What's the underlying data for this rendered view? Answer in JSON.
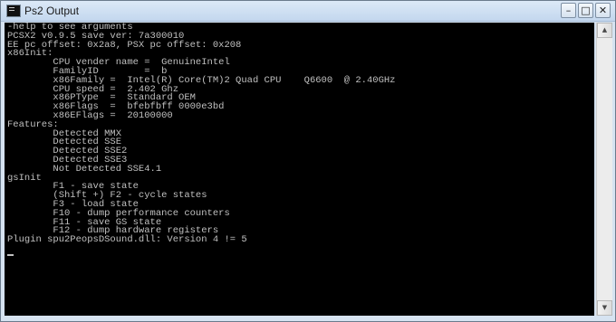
{
  "window": {
    "title": "Ps2 Output",
    "controls": {
      "minimize_glyph": "–",
      "maximize_glyph": "□",
      "close_glyph": "✕"
    },
    "icon": "console-app-icon"
  },
  "console": {
    "background": "#000000",
    "text_color": "#c0c0c0",
    "lines": [
      "-help to see arguments",
      "PCSX2 v0.9.5 save ver: 7a300010",
      "EE pc offset: 0x2a8, PSX pc offset: 0x208",
      "x86Init:",
      "        CPU vender name =  GenuineIntel",
      "        FamilyID        =  b",
      "        x86Family =  Intel(R) Core(TM)2 Quad CPU    Q6600  @ 2.40GHz",
      "        CPU speed =  2.402 Ghz",
      "        x86PType  =  Standard OEM",
      "        x86Flags  =  bfebfbff 0000e3bd",
      "        x86EFlags =  20100000",
      "Features:",
      "        Detected MMX",
      "        Detected SSE",
      "        Detected SSE2",
      "        Detected SSE3",
      "        Not Detected SSE4.1",
      "gsInit",
      "        F1 - save state",
      "        (Shift +) F2 - cycle states",
      "        F3 - load state",
      "        F10 - dump performance counters",
      "        F11 - save GS state",
      "        F12 - dump hardware registers",
      "Plugin spu2PeopsDSound.dll: Version 4 != 5"
    ]
  },
  "scrollbar": {
    "up_glyph": "▲",
    "down_glyph": "▼"
  }
}
